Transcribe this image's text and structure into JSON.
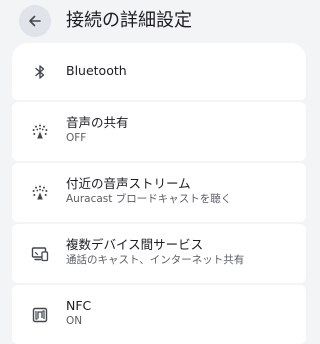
{
  "header": {
    "title": "接続の詳細設定"
  },
  "items": [
    {
      "label": "Bluetooth",
      "sub": ""
    },
    {
      "label": "音声の共有",
      "sub": "OFF"
    },
    {
      "label": "付近の音声ストリーム",
      "sub": "Auracast ブロードキャストを聴く"
    },
    {
      "label": "複数デバイス間サービス",
      "sub": "通話のキャスト、インターネット共有"
    },
    {
      "label": "NFC",
      "sub": "ON"
    }
  ],
  "icons": [
    "back-arrow-icon",
    "bluetooth-icon",
    "audio-share-icon",
    "audio-stream-icon",
    "cross-device-icon",
    "nfc-icon"
  ],
  "colors": {
    "background": "#f3f4f6",
    "card": "#ffffff",
    "back_button": "#e1e3ea",
    "text_primary": "#1c1c22",
    "text_secondary": "#5b5e66",
    "icon": "#43474e"
  }
}
